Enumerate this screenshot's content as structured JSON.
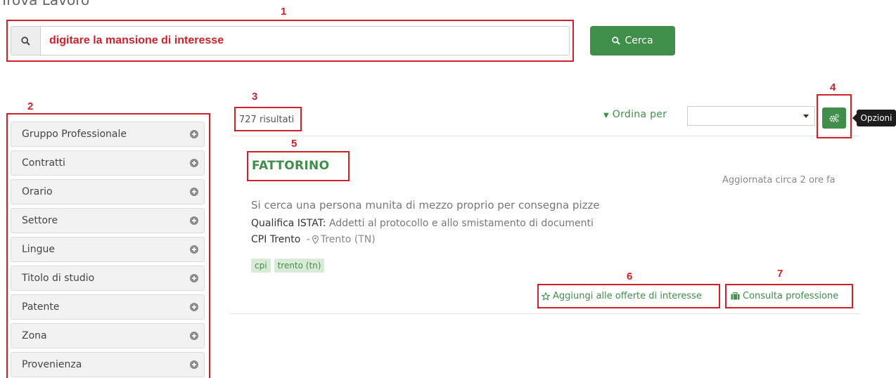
{
  "page": {
    "title": "Trova Lavoro"
  },
  "annotations": [
    "1",
    "2",
    "3",
    "4",
    "5",
    "6",
    "7"
  ],
  "search": {
    "placeholder": "digitare la mansione di interesse",
    "button_label": "Cerca"
  },
  "sidebar": {
    "items": [
      {
        "label": "Gruppo Professionale"
      },
      {
        "label": "Contratti"
      },
      {
        "label": "Orario"
      },
      {
        "label": "Settore"
      },
      {
        "label": "Lingue"
      },
      {
        "label": "Titolo di studio"
      },
      {
        "label": "Patente"
      },
      {
        "label": "Zona"
      },
      {
        "label": "Provenienza"
      }
    ]
  },
  "results": {
    "count_label": "727 risultati",
    "order_label": "Ordina per",
    "order_value": "",
    "options_tooltip": "Opzioni"
  },
  "job": {
    "title": "FATTORINO",
    "updated": "Aggiornata circa 2 ore fa",
    "description": "Si cerca una persona munita di mezzo proprio per consegna pizze",
    "qualifica_label": "Qualifica ISTAT:",
    "qualifica_value": "Addetti al protocollo e allo smistamento di documenti",
    "cpi": "CPI Trento",
    "location": "Trento (TN)",
    "tags": [
      "cpi",
      "trento (tn)"
    ],
    "add_interest_label": "Aggiungi alle offerte di interesse",
    "consult_label": "Consulta professione"
  },
  "colors": {
    "accent": "#3f8f4a",
    "annotation": "#d0202a"
  }
}
